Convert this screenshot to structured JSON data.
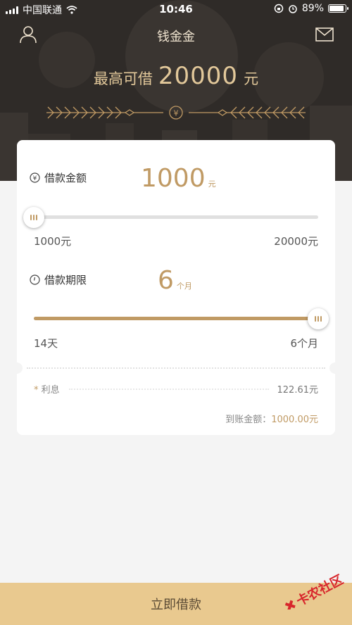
{
  "status_bar": {
    "carrier": "中国联通",
    "time": "10:46",
    "battery": "89%",
    "battery_level": 0.89
  },
  "nav": {
    "title": "钱金金",
    "left_icon": "user-icon",
    "right_icon": "mail-icon"
  },
  "hero": {
    "label": "最高可借",
    "amount": "20000",
    "unit": "元",
    "ornament_center_icon": "yen-icon"
  },
  "amount": {
    "label": "借款金额",
    "value": "1000",
    "unit": "元",
    "min_label": "1000元",
    "max_label": "20000元",
    "slider_fraction": 0.0
  },
  "term": {
    "label": "借款期限",
    "value": "6",
    "unit": "个月",
    "min_label": "14天",
    "max_label": "6个月",
    "slider_fraction": 1.0
  },
  "summary": {
    "interest_star": "*",
    "interest_label": "利息",
    "interest_value": "122.61元",
    "received_label": "到账金额：",
    "received_value": "1000.00元"
  },
  "footer": {
    "button_label": "立即借款"
  },
  "watermark": {
    "text": "卡农社区"
  },
  "colors": {
    "header_bg": "#2f2b28",
    "gold": "#c09a64",
    "button_bg": "#e9c98f",
    "page_bg": "#f4f4f4"
  }
}
